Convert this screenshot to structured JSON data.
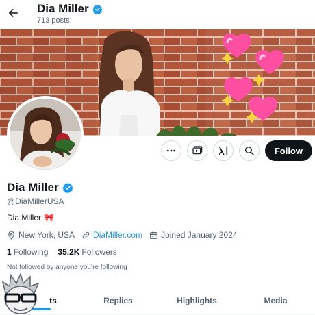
{
  "header": {
    "title": "Dia Miller",
    "posts_count": "713 posts"
  },
  "profile": {
    "name": "Dia Miller",
    "handle": "@DiaMillerUSA",
    "bio": "Dia Miller",
    "bio_emoji": "🎀",
    "location": "New York, USA",
    "website": "DiaMiller.com",
    "joined": "Joined January 2024",
    "following_count": "1",
    "following_label": "Following",
    "followers_count": "35.2K",
    "followers_label": "Followers",
    "not_followed_text": "Not followed by anyone you’re following"
  },
  "actions": {
    "follow_label": "Follow"
  },
  "tabs": [
    {
      "label": "Posts",
      "visible_text": "ts",
      "active": true
    },
    {
      "label": "Replies",
      "visible_text": "Replies",
      "active": false
    },
    {
      "label": "Highlights",
      "visible_text": "Highlights",
      "active": false
    },
    {
      "label": "Media",
      "visible_text": "Media",
      "active": false
    }
  ],
  "colors": {
    "accent": "#1d9bf0",
    "text_primary": "#0f1419",
    "text_secondary": "#536471",
    "follow_button_bg": "#0f1419",
    "verified_badge": "#1d9bf0"
  },
  "icons": {
    "back": "arrow-left-icon",
    "verified": "verified-badge-icon",
    "more": "more-dots-icon",
    "subscribe": "subscribe-camera-icon",
    "grok": "grok-icon",
    "search": "search-icon",
    "location": "location-pin-icon",
    "link": "link-icon",
    "calendar": "calendar-icon"
  }
}
